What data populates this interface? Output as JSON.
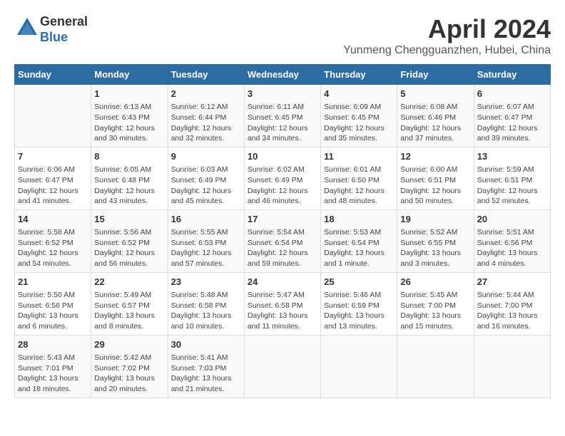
{
  "header": {
    "logo_line1": "General",
    "logo_line2": "Blue",
    "title": "April 2024",
    "location": "Yunmeng Chengguanzhen, Hubei, China"
  },
  "columns": [
    "Sunday",
    "Monday",
    "Tuesday",
    "Wednesday",
    "Thursday",
    "Friday",
    "Saturday"
  ],
  "weeks": [
    [
      {
        "day": "",
        "info": ""
      },
      {
        "day": "1",
        "info": "Sunrise: 6:13 AM\nSunset: 6:43 PM\nDaylight: 12 hours\nand 30 minutes."
      },
      {
        "day": "2",
        "info": "Sunrise: 6:12 AM\nSunset: 6:44 PM\nDaylight: 12 hours\nand 32 minutes."
      },
      {
        "day": "3",
        "info": "Sunrise: 6:11 AM\nSunset: 6:45 PM\nDaylight: 12 hours\nand 34 minutes."
      },
      {
        "day": "4",
        "info": "Sunrise: 6:09 AM\nSunset: 6:45 PM\nDaylight: 12 hours\nand 35 minutes."
      },
      {
        "day": "5",
        "info": "Sunrise: 6:08 AM\nSunset: 6:46 PM\nDaylight: 12 hours\nand 37 minutes."
      },
      {
        "day": "6",
        "info": "Sunrise: 6:07 AM\nSunset: 6:47 PM\nDaylight: 12 hours\nand 39 minutes."
      }
    ],
    [
      {
        "day": "7",
        "info": "Sunrise: 6:06 AM\nSunset: 6:47 PM\nDaylight: 12 hours\nand 41 minutes."
      },
      {
        "day": "8",
        "info": "Sunrise: 6:05 AM\nSunset: 6:48 PM\nDaylight: 12 hours\nand 43 minutes."
      },
      {
        "day": "9",
        "info": "Sunrise: 6:03 AM\nSunset: 6:49 PM\nDaylight: 12 hours\nand 45 minutes."
      },
      {
        "day": "10",
        "info": "Sunrise: 6:02 AM\nSunset: 6:49 PM\nDaylight: 12 hours\nand 46 minutes."
      },
      {
        "day": "11",
        "info": "Sunrise: 6:01 AM\nSunset: 6:50 PM\nDaylight: 12 hours\nand 48 minutes."
      },
      {
        "day": "12",
        "info": "Sunrise: 6:00 AM\nSunset: 6:51 PM\nDaylight: 12 hours\nand 50 minutes."
      },
      {
        "day": "13",
        "info": "Sunrise: 5:59 AM\nSunset: 6:51 PM\nDaylight: 12 hours\nand 52 minutes."
      }
    ],
    [
      {
        "day": "14",
        "info": "Sunrise: 5:58 AM\nSunset: 6:52 PM\nDaylight: 12 hours\nand 54 minutes."
      },
      {
        "day": "15",
        "info": "Sunrise: 5:56 AM\nSunset: 6:52 PM\nDaylight: 12 hours\nand 56 minutes."
      },
      {
        "day": "16",
        "info": "Sunrise: 5:55 AM\nSunset: 6:53 PM\nDaylight: 12 hours\nand 57 minutes."
      },
      {
        "day": "17",
        "info": "Sunrise: 5:54 AM\nSunset: 6:54 PM\nDaylight: 12 hours\nand 59 minutes."
      },
      {
        "day": "18",
        "info": "Sunrise: 5:53 AM\nSunset: 6:54 PM\nDaylight: 13 hours\nand 1 minute."
      },
      {
        "day": "19",
        "info": "Sunrise: 5:52 AM\nSunset: 6:55 PM\nDaylight: 13 hours\nand 3 minutes."
      },
      {
        "day": "20",
        "info": "Sunrise: 5:51 AM\nSunset: 6:56 PM\nDaylight: 13 hours\nand 4 minutes."
      }
    ],
    [
      {
        "day": "21",
        "info": "Sunrise: 5:50 AM\nSunset: 6:56 PM\nDaylight: 13 hours\nand 6 minutes."
      },
      {
        "day": "22",
        "info": "Sunrise: 5:49 AM\nSunset: 6:57 PM\nDaylight: 13 hours\nand 8 minutes."
      },
      {
        "day": "23",
        "info": "Sunrise: 5:48 AM\nSunset: 6:58 PM\nDaylight: 13 hours\nand 10 minutes."
      },
      {
        "day": "24",
        "info": "Sunrise: 5:47 AM\nSunset: 6:58 PM\nDaylight: 13 hours\nand 11 minutes."
      },
      {
        "day": "25",
        "info": "Sunrise: 5:46 AM\nSunset: 6:59 PM\nDaylight: 13 hours\nand 13 minutes."
      },
      {
        "day": "26",
        "info": "Sunrise: 5:45 AM\nSunset: 7:00 PM\nDaylight: 13 hours\nand 15 minutes."
      },
      {
        "day": "27",
        "info": "Sunrise: 5:44 AM\nSunset: 7:00 PM\nDaylight: 13 hours\nand 16 minutes."
      }
    ],
    [
      {
        "day": "28",
        "info": "Sunrise: 5:43 AM\nSunset: 7:01 PM\nDaylight: 13 hours\nand 18 minutes."
      },
      {
        "day": "29",
        "info": "Sunrise: 5:42 AM\nSunset: 7:02 PM\nDaylight: 13 hours\nand 20 minutes."
      },
      {
        "day": "30",
        "info": "Sunrise: 5:41 AM\nSunset: 7:03 PM\nDaylight: 13 hours\nand 21 minutes."
      },
      {
        "day": "",
        "info": ""
      },
      {
        "day": "",
        "info": ""
      },
      {
        "day": "",
        "info": ""
      },
      {
        "day": "",
        "info": ""
      }
    ]
  ]
}
